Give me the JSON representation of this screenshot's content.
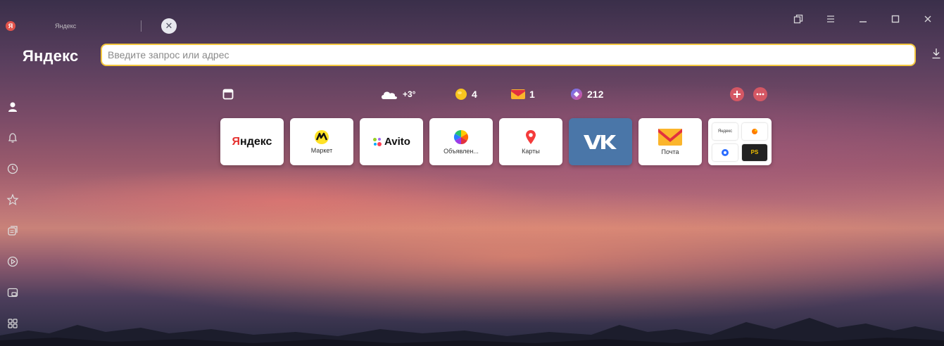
{
  "browser": {
    "tab_title": "Яндекс",
    "brand": "Яндекс",
    "address_placeholder": "Введите запрос или адрес",
    "accent_color": "#f4c73e"
  },
  "window_controls": [
    "tabs-icon",
    "menu-icon",
    "minimize-icon",
    "maximize-icon",
    "close-icon"
  ],
  "sidebar": {
    "items": [
      {
        "name": "profile",
        "icon": "user-icon"
      },
      {
        "name": "notifications",
        "icon": "bell-icon"
      },
      {
        "name": "history",
        "icon": "clock-icon"
      },
      {
        "name": "bookmarks",
        "icon": "star-icon"
      },
      {
        "name": "collections",
        "icon": "collections-icon"
      },
      {
        "name": "video",
        "icon": "play-icon"
      },
      {
        "name": "picture-in-picture",
        "icon": "pip-icon"
      },
      {
        "name": "apps",
        "icon": "apps-icon"
      }
    ]
  },
  "widgets": {
    "weather": "+3°",
    "coins": "4",
    "mail": "1",
    "messenger": "212"
  },
  "tiles": [
    {
      "id": "yandex",
      "label": "Яндекс",
      "caption": ""
    },
    {
      "id": "market",
      "label": "",
      "caption": "Маркет"
    },
    {
      "id": "avito",
      "label": "Avito",
      "caption": ""
    },
    {
      "id": "ads",
      "label": "",
      "caption": "Объявлен..."
    },
    {
      "id": "maps",
      "label": "",
      "caption": "Карты"
    },
    {
      "id": "vk",
      "label": "",
      "caption": ""
    },
    {
      "id": "mail",
      "label": "",
      "caption": "Почта"
    },
    {
      "id": "group",
      "label": "",
      "caption": ""
    }
  ],
  "tile_group": {
    "mini_label": "Яндекс",
    "kinopoisk_label": "PS"
  }
}
